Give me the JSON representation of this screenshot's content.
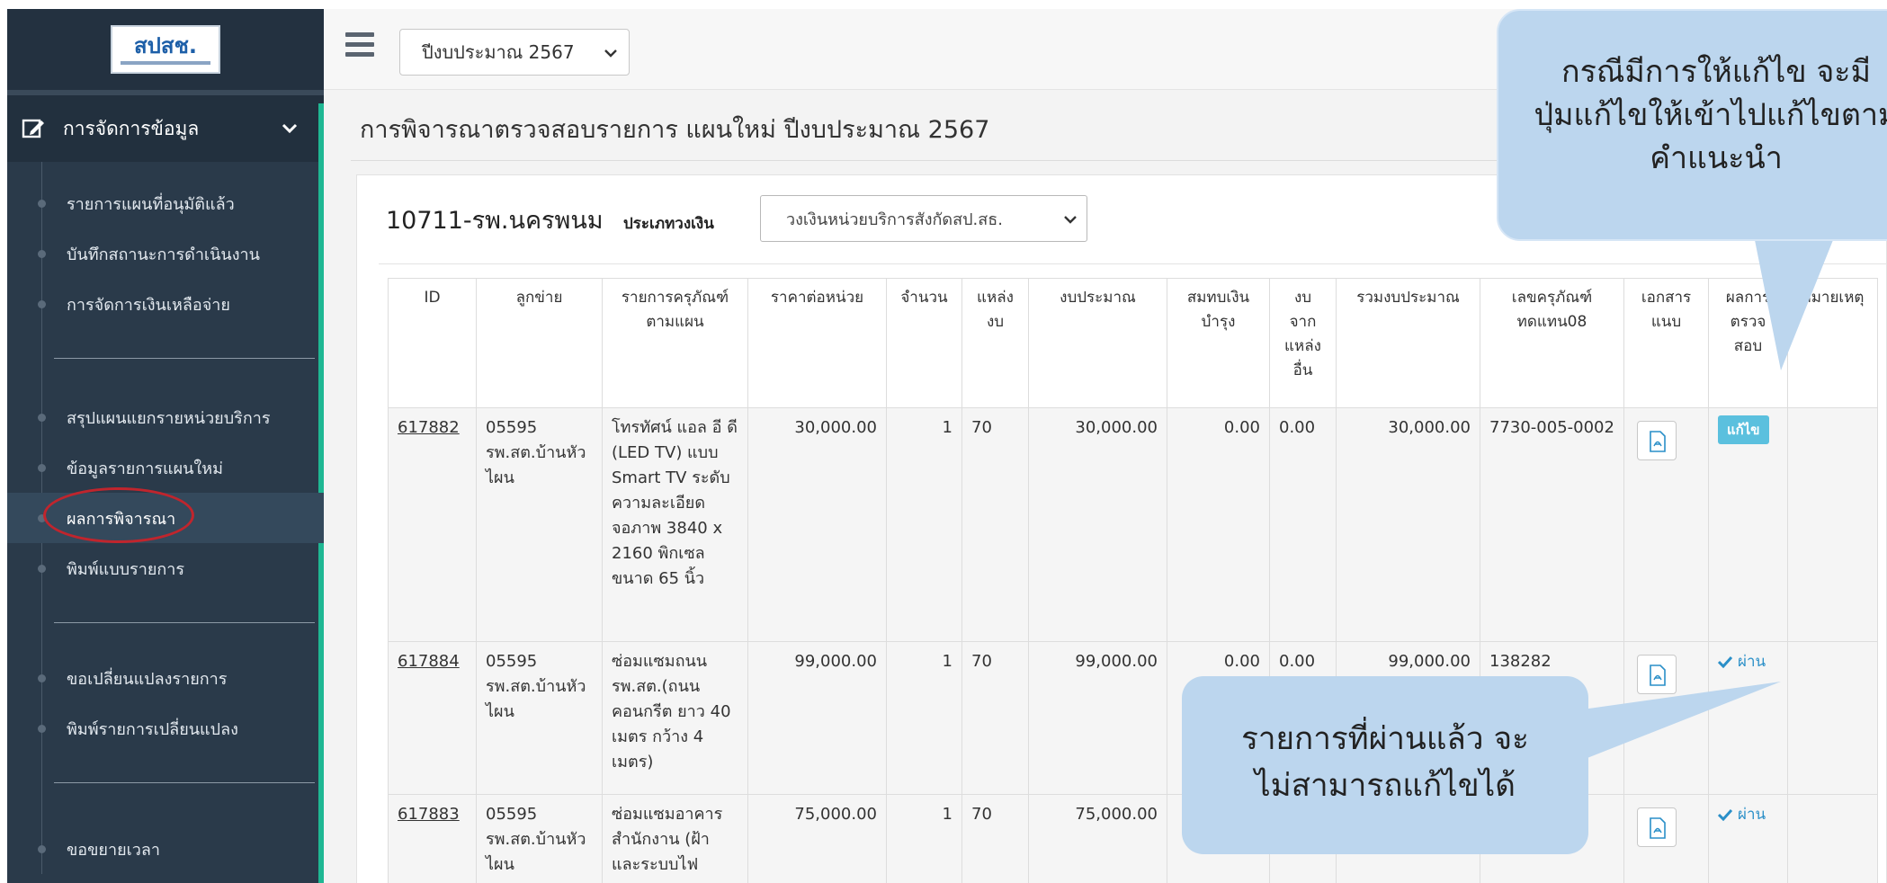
{
  "sidebar": {
    "logo_text": "สปสช.",
    "section_label": "การจัดการข้อมูล",
    "items": [
      {
        "label": "รายการแผนที่อนุมัติแล้ว"
      },
      {
        "label": "บันทึกสถานะการดำเนินงาน"
      },
      {
        "label": "การจัดการเงินเหลือจ่าย"
      },
      {
        "label": "สรุปแผนแยกรายหน่วยบริการ"
      },
      {
        "label": "ข้อมูลรายการแผนใหม่"
      },
      {
        "label": "ผลการพิจารณา"
      },
      {
        "label": "พิมพ์แบบรายการ"
      },
      {
        "label": "ขอเปลี่ยนแปลงรายการ"
      },
      {
        "label": "พิมพ์รายการเปลี่ยนแปลง"
      },
      {
        "label": "ขอขยายเวลา"
      }
    ],
    "active_item": "ผลการพิจารณา"
  },
  "topbar": {
    "year_select_value": "ปีงบประมาณ 2567"
  },
  "page": {
    "title": "การพิจารณาตรวจสอบรายการ แผนใหม่ ปีงบประมาณ 2567",
    "hospital": "10711-รพ.นครพนม",
    "money_type_label": "ประเภทวงเงิน",
    "money_type_value": "วงเงินหน่วยบริการสังกัดสป.สธ."
  },
  "table": {
    "headers": {
      "id": "ID",
      "network": "ลูกข่าย",
      "item": "รายการครุภัณฑ์ ตามแผน",
      "unit_price": "ราคาต่อหน่วย",
      "qty": "จำนวน",
      "source": "แหล่ง งบ",
      "budget": "งบประมาณ",
      "support": "สมทบเงิน บำรุง",
      "other": "งบ จาก แหล่ง อื่น",
      "total": "รวมงบประมาณ",
      "replace": "เลขครุภัณฑ์ ทดแทน08",
      "docs": "เอกสาร แนบ",
      "result": "ผลการ ตรวจ สอบ",
      "note": "หมายเหตุ"
    },
    "rows": [
      {
        "id": "617882",
        "network": "05595 รพ.สต.บ้านหัวไผน",
        "item": "โทรทัศน์ แอล อี ดี (LED TV) แบบ Smart TV ระดับความละเอียดจอภาพ 3840 x 2160 พิกเซล ขนาด 65 นิ้ว",
        "unit_price": "30,000.00",
        "qty": "1",
        "source": "70",
        "budget": "30,000.00",
        "support": "0.00",
        "other": "0.00",
        "total": "30,000.00",
        "replace": "7730-005-0002",
        "result": "แก้ไข"
      },
      {
        "id": "617884",
        "network": "05595 รพ.สต.บ้านหัวไผน",
        "item": "ซ่อมแซมถนน รพ.สต.(ถนนคอนกรีต ยาว 40 เมตร กว้าง 4 เมตร)",
        "unit_price": "99,000.00",
        "qty": "1",
        "source": "70",
        "budget": "99,000.00",
        "support": "0.00",
        "other": "0.00",
        "total": "99,000.00",
        "replace": "138282",
        "result": "ผ่าน"
      },
      {
        "id": "617883",
        "network": "05595 รพ.สต.บ้านหัวไผน",
        "item": "ซ่อมแซมอาคารสำนักงาน (ฝ้าและระบบไฟ",
        "unit_price": "75,000.00",
        "qty": "1",
        "source": "70",
        "budget": "75,000.00",
        "result": "ผ่าน"
      }
    ]
  },
  "callouts": {
    "top_line1": "กรณีมีการให้แก้ไข จะมี",
    "top_line2": "ปุ่มแก้ไขให้เข้าไปแก้ไขตาม",
    "top_line3": "คำแนะนำ",
    "bottom_line1": "รายการที่ผ่านแล้ว จะ",
    "bottom_line2": "ไม่สามารถแก้ไขได้"
  },
  "colors": {
    "sidebar_bg": "#2a3a4a",
    "accent_green": "#1fb793",
    "edit_button": "#5bc0de",
    "pass_blue": "#2a8fc8",
    "callout_bg": "#bcd6ee",
    "annotation_red": "#c0252d"
  },
  "icons": [
    "edit-icon",
    "chevron-down-icon",
    "hamburger-icon",
    "pdf-icon",
    "check-icon"
  ]
}
